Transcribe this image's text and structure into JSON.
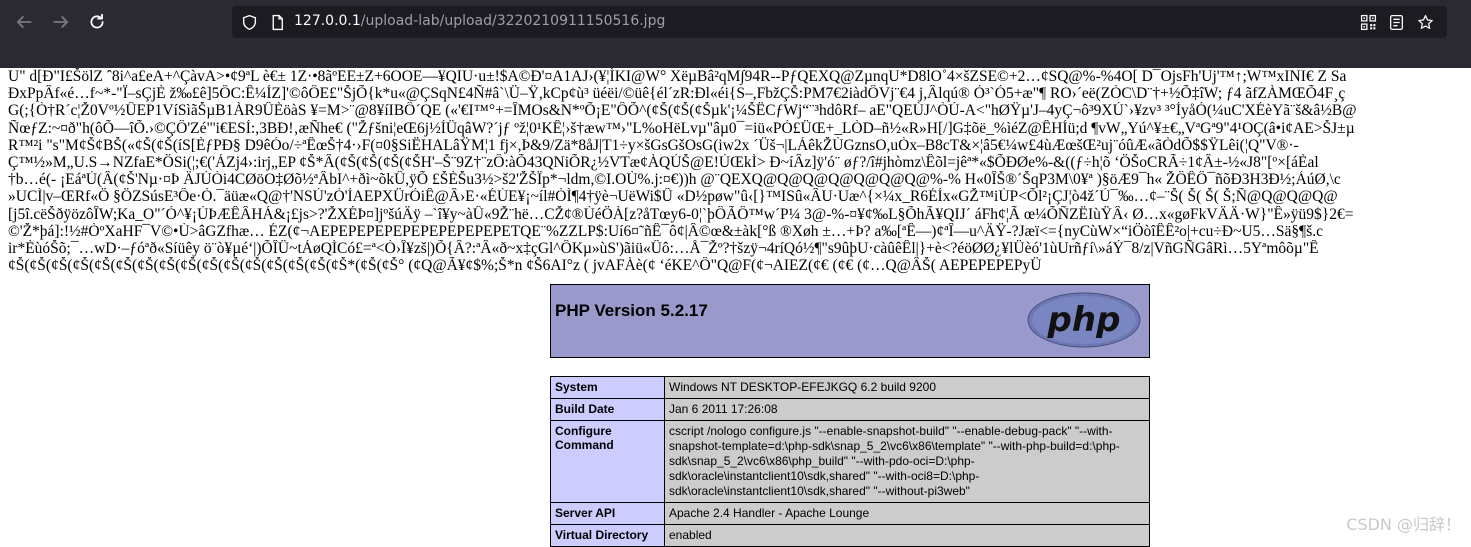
{
  "browser": {
    "url_host": "127.0.0.1",
    "url_path": "/upload-lab/upload/3220210911150516.jpg"
  },
  "garbled_lines": [
    "U\" d[Ð\"I£ŠölZ ˆ8i^a£eA+^ÇàvA>•¢9ªL è€± 1Z·•8ãºEE±Z+6OOE—¥QIU·u±!$A©Ð'¤A1AJ›(¥¦ÌKI@W° XëµBâ²qM∫94R--PƒQEXQ@ZµnqU*D8lO˚4×šZSE©+2…¢SQ@%-%4O[ D¯OjsFh'Uj'™↑;W™xINI€ Z Sa",
    "ÐxPpÂf«é…f~*-\"Ï–sÇjÈ ž‰£ê]5ÔC:Ê¼ÍZ]'©ôÔE£\"ŠjÕ{k*u«@ÇSqN£4Ñ#â`\\Ü–Ÿ,kCp¢ù³ üéëi/©üê{él´zR:Ðl«éi{S–,FbžÇŠ:PM7€2iàdÔVj¨€4 j,Âlqú® Ó³`Ó5+æ\"¶ RO›´eë(ZÒC\\D¨†+½Õ‡îW; ƒ4 ãfZÀMŒÕ4F¸ç",
    "G(;{Ò†R´c¦Ž0Vº½ÛEP1VíSìãŠµB1ÀR9ÛÈöàS ¥=M>¨@8¥íIBÔ´QE («'€I™°+=ÎMOs&N*ºÕ¡E\"ÔÕ^(¢Š(¢Š(¢Šµk'¡¼ŠËCƒWj“¨³hdôRf– aE\"QEÙJ^ÒÚ-A<\"hØŸµ'J–4yÇ¬ô³9XÚ`›¥zv³ ³°ÍyåÓ(¼uC'XÉèYã¨š&â½B@",
    "ÑœƒZ:~¤ð\"h(ôÕ—îÕ.›©ÇÔ'Zé\"'i€ESÍ:,3BÐ!‚æÑhe€ (\"Žƒšni¦eŒ6j½ÍÜqâW?´jƒ ºž¦0¹KÊ¦›š†æw™›\"L%oHëLvµ\"âµ0¯=iü«PÓ£ÜŒ+_LÒD–ñ½«R»H[/]G‡õë_%ìéZ@ÊHÍü;d ¶vW„Yú^¥±€„VªGª9\"4¹OÇ(â•i¢AE>ŠJ±µ",
    "R™²i \"s\"M¢Š¢BŠ(«¢Š(¢Š(íS[ÈƒPÐ§ D9êÓo/÷ªÊœŠ†4·›F(¤0§SiËHALâŸM¦1 fj×,Þ&9/Zä*8åJ|T1÷y×šGsGšOsG(iw2x ´Üš¬|LÁêkŽÙGznsO,uÒx–B8cT&×¦â5€¼w£4ùÆœšŒ²uj¨óûÆ«ãÒdÕ$$ŸLêi(¦Q\"V®·-",
    "Ç™½»M„U.S→NZfaE*ÖSi(¦;€('ÁZj4›:irj„EP ¢Š*Â(¢Š(¢Š(¢Š(¢ŠH'–Š¨9Z†¨zÔ:àÕ43QNiÕR¿½VTæ¢ÀQÚŠ@E!ÚŒkÌ> Ð~íÂz]ÿ'ó¨ øƒ?/î#jhòmz\\Êõl=jêª*«$ÕÐØe%-&((ƒ÷h¦õ ‘ÖŠoCRÃ÷1¢Â±-½«J8\"[º×[áÈal",
    "†b…é(- ¡EáªÚ(Â(¢Š'Nµ·¤Þ ÄJÙÒi4CØöO‡Øõ½ªÂbI^+ðì~õkÛ,ÿÕ £ŠÈŠu3½>š2'ŽŠÏp*¬ldm,©I.OÙ%.j:¤€))h @¨QEXQ@Q@Q@Q@Q@Q@Q@%-% H«0ÎŠ®´ŠqP3M\\0¥ª )§öÆ9¯h« ŽÔÊÔ¯ñõÐ3H3Ð½;ÁúØ,\\c",
    "»UCÌ|v–ŒRf«Ö §ÖZSúsE³Ôe·Ò.¯äüæ«Q@†'NSÚ'zÒ'ÍAEPXÜrÓiÊ@Â›E·«ÉÙE¥¡~íl#ÒÌ¶4†ÿè¬UëWi$Û «D½pøw\"û‹[}™ISû«ÂU·Uæ^{×¼x_R6ÉÍx«GŽ™iÙP<Õl²¡ÇJ¦ò4ž´Ú¯‰…¢–¨Š( Š( Š( Š;Ñ@Q@Q@Q@",
    "[j5î.cëŠðÿözôÎW;Ka_O\"´Ó^¥¡ÚÞÆÊÂHÁ&¡£js>?'ŽXÉÞ¤]jºšúÄÿ –`î¥y~àÛ«9Ž¨hë…CŽ¢®ÙéÖÀ[z?åTœy6-0¦`þÔÃÔ™w´P¼ 3@-%-¤¥¢‰L§ÕhÃ¥QIJ´ áFh¢¦Ã œ¼ÕÑZËIùŸÂ‹ Ø…x«gøFkVÄÄ·W}\"Ê»ÿü9$}2€=",
    "©'Ž*þá]:!½#ÒºXaHF¯V©•Ù>âGZfhæ… ÉZ(¢¬AEPEPEPEPEPEPEPEPEPEPETQE¨%ZZLP$:Uí6¤˜ñÊ¯ô¢|Â©œ&±àk[°ß ®Xøh ±…+Þ? a‰[ªÊ—)¢ªÎ—u^ÄŸ-?Jæï<={nyCùW×“iÖòîÊÊ²o|+cu÷Ð~U5…Sä§¶š.c",
    "ir*ÈùóŠõ;¯…wD·–ƒóªð«Síüêy ö¨ò¥µé‘|)ÕÎÜ~tÁøQÌCó£=ª<Ò›Î¥zš|)Õ{Â?:ªÂ«ð~x‡çGl^ÔKµ»ùS')ãiü«Ûô:…Å¯Žº?†šzÿ¬4ríQó½¶\"s9ûþU·càûêÊl|}+è<?éöØØ¿¥lÜèó'1ùUrñƒí\\»áÝ¯8/z|VñGÑGâRì…5Yªmôõµ\"Ê",
    "¢Š(¢Š(¢Š(¢Š(¢Š(¢Š(¢Š(¢Š(¢Š(¢Š(¢Š(¢Š(¢Š(¢Š(¢Š(¢Š*(¢Š(¢Š° (¢Q@Ã¥¢$%;Š*n ¢Š6AI°z ( jvAFÀè(¢ ‘éKE^Ô\"Q@F(¢¬AIEZ(¢€ (¢€ (¢…Q@ÂŠ( AEPEPEPEPyÜ"
  ],
  "php": {
    "title": "PHP Version 5.2.17",
    "logo_text": "php",
    "rows": [
      {
        "key": "System",
        "value": "Windows NT DESKTOP-EFEJKGQ 6.2 build 9200"
      },
      {
        "key": "Build Date",
        "value": "Jan 6 2011 17:26:08"
      },
      {
        "key": "Configure Command",
        "value": "cscript /nologo configure.js \"--enable-snapshot-build\" \"--enable-debug-pack\" \"--with-snapshot-template=d:\\php-sdk\\snap_5_2\\vc6\\x86\\template\" \"--with-php-build=d:\\php-sdk\\snap_5_2\\vc6\\x86\\php_build\" \"--with-pdo-oci=D:\\php-sdk\\oracle\\instantclient10\\sdk,shared\" \"--with-oci8=D:\\php-sdk\\oracle\\instantclient10\\sdk,shared\" \"--without-pi3web\""
      },
      {
        "key": "Server API",
        "value": "Apache 2.4 Handler - Apache Lounge"
      },
      {
        "key": "Virtual Directory",
        "value": "enabled"
      }
    ]
  },
  "watermark": "CSDN @归辞！",
  "colors": {
    "toolbar_bg": "#2b2a33",
    "urlbar_bg": "#1c1b22",
    "php_header_bg": "#9999cc",
    "php_key_bg": "#ccccff",
    "php_value_bg": "#cccccc"
  }
}
